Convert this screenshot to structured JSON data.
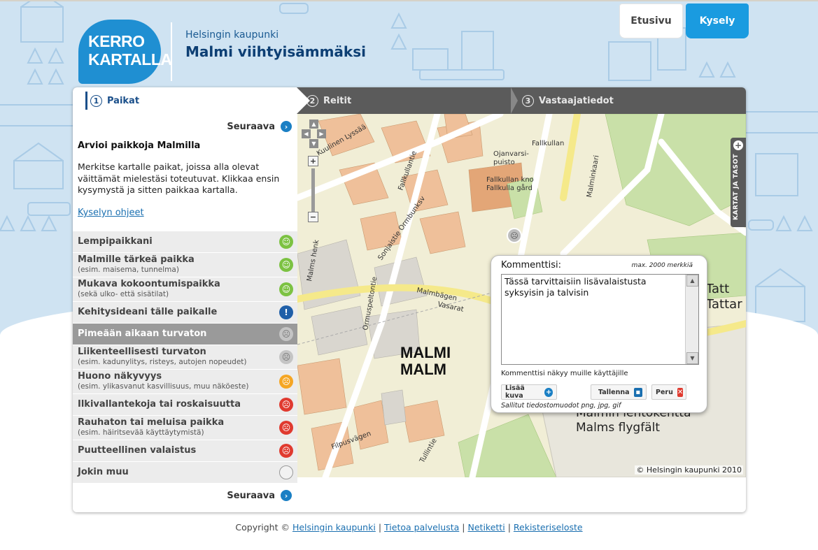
{
  "header": {
    "logo_line1": "KERRO",
    "logo_line2": "KARTALLA",
    "city": "Helsingin kaupunki",
    "title": "Malmi viihtyisämmäksi"
  },
  "top_nav": {
    "home": "Etusivu",
    "survey": "Kysely"
  },
  "steps": [
    {
      "num": "1",
      "label": "Paikat"
    },
    {
      "num": "2",
      "label": "Reitit"
    },
    {
      "num": "3",
      "label": "Vastaajatiedot"
    }
  ],
  "sidebar": {
    "next_label": "Seuraava",
    "intro_title": "Arvioi paikkoja Malmilla",
    "intro_text": "Merkitse kartalle paikat, joissa alla olevat väittämät mielestäsi toteutuvat. Klikkaa ensin kysymystä ja sitten paikkaa kartalla.",
    "help_link": "Kyselyn ohjeet",
    "categories": [
      {
        "label": "Lempipaikkani",
        "sub": "",
        "icon": "happy"
      },
      {
        "label": "Malmille tärkeä paikka",
        "sub": "(esim. maisema, tunnelma)",
        "icon": "happy"
      },
      {
        "label": "Mukava kokoontumispaikka",
        "sub": "(sekä ulko- että sisätilat)",
        "icon": "happy"
      },
      {
        "label": "Kehitysideani tälle paikalle",
        "sub": "",
        "icon": "idea"
      },
      {
        "label": "Pimeään aikaan turvaton",
        "sub": "",
        "icon": "sad-grey"
      },
      {
        "label": "Liikenteellisesti turvaton",
        "sub": "(esim. kadunylitys, risteys, autojen nopeudet)",
        "icon": "sad-grey"
      },
      {
        "label": "Huono näkyvyys",
        "sub": "(esim. ylikasvanut kasvillisuus, muu näköeste)",
        "icon": "sad-orange"
      },
      {
        "label": "Ilkivallantekoja tai roskaisuutta",
        "sub": "",
        "icon": "sad-red"
      },
      {
        "label": "Rauhaton tai meluisa paikka",
        "sub": "(esim. häiritsevää käyttäytymistä)",
        "icon": "sad-red"
      },
      {
        "label": "Puutteellinen valaistus",
        "sub": "",
        "icon": "sad-red"
      },
      {
        "label": "Jokin muu",
        "sub": "",
        "icon": "other"
      }
    ],
    "active_index": 4
  },
  "map": {
    "layers_label": "KARTAT JA TASOT",
    "copyright": "© Helsingin kaupunki 2010",
    "district_fi": "MALMI",
    "district_sv": "MALM",
    "airport_fi": "Malmin lentokenttä",
    "airport_sv": "Malms flygfält",
    "tattar_1": "Tatt",
    "tattar_2": "Tattar"
  },
  "popup": {
    "title": "Kommenttisi:",
    "max_chars": "max. 2000 merkkiä",
    "comment": "Tässä tarvittaisiin lisävalaistusta syksyisin ja talvisin",
    "visibility_note": "Kommenttisi näkyy muille käyttäjille",
    "add_image": "Lisää kuva",
    "save": "Tallenna",
    "cancel": "Peru",
    "formats": "Sallitut tiedostomuodot png, jpg, gif"
  },
  "footer": {
    "copyright": "Copyright ©",
    "links": [
      "Helsingin kaupunki",
      "Tietoa palvelusta",
      "Netiketti",
      "Rekisteriseloste"
    ]
  },
  "colors": {
    "accent": "#1a9be0",
    "happy": "#7cc242",
    "idea": "#1f5fa8",
    "sad_grey": "#c4c4c4",
    "sad_orange": "#f5a623",
    "sad_red": "#e03a2f",
    "other": "#f2f2f2"
  }
}
